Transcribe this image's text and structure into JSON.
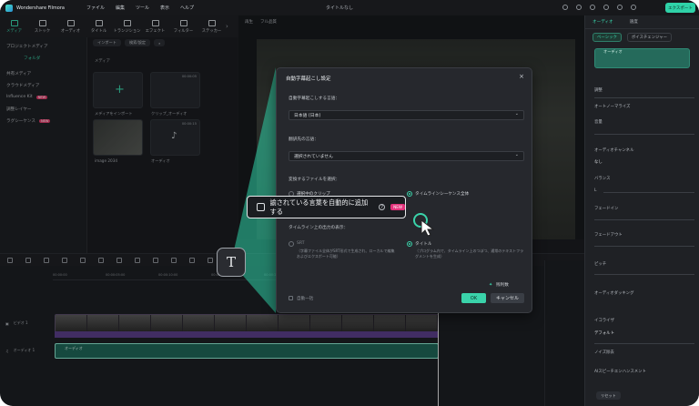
{
  "app": {
    "name": "Wondershare Filmora",
    "window_title": "タイトルなし",
    "export_label": "エクスポート"
  },
  "menu": [
    "ファイル",
    "編集",
    "ツール",
    "表示",
    "ヘルプ"
  ],
  "tools": [
    "メディア",
    "ストック",
    "オーディオ",
    "タイトル",
    "トランジション",
    "エフェクト",
    "フィルター",
    "ステッカー"
  ],
  "left_panel": {
    "items": [
      "プロジェクトメディア",
      "フォルダ",
      "共有メディア",
      "クラウドメディア",
      "Influence Kit",
      "調整レイヤー",
      "ラグシーケンス"
    ],
    "new_badge": "NEW"
  },
  "media": {
    "import_label": "インポート",
    "filter_label": "検索/設定",
    "folder_label": "メディア",
    "items": [
      {
        "caption": "メディアをインポート"
      },
      {
        "caption": "クリップ_オーディオ",
        "time": "00:00:05"
      },
      {
        "caption": "image 2034"
      },
      {
        "caption": "オーディオ",
        "time": "00:00:15"
      }
    ]
  },
  "preview": {
    "label": "再生",
    "quality": "フル品質"
  },
  "right_panel": {
    "tabs": [
      "オーディオ",
      "速度"
    ],
    "subtabs": [
      "ベーシック",
      "ボイスチェンジャー"
    ],
    "wave_label": "オーディオ",
    "sections": [
      "調整",
      "オートノーマライズ",
      "音量",
      "オーディオチャンネル",
      "なし",
      "バランス",
      "L",
      "フェードイン",
      "フェードアウト",
      "ピッチ",
      "オーディオダッキング",
      "イコライザ",
      "デフォルト",
      "ノイズ除去",
      "AIスピーチエンハンスメント"
    ],
    "reset_label": "リセット"
  },
  "timeline": {
    "ruler": [
      "00:00:00",
      "00:00:05:00",
      "00:00:10:00",
      "00:00:15:00",
      "00:00:20:00",
      "00:00:25:00"
    ],
    "video_track": "ビデオ 1",
    "audio_track": "オーディオ 1",
    "audio_clip_label": "オーディオ"
  },
  "dialog": {
    "title": "自動字幕起こし設定",
    "source_lang_label": "自動字幕起こしする言語：",
    "source_lang_value": "日本語 (日本)",
    "translate_label": "翻訳先の言語：",
    "translate_value": "選択されていません",
    "file_label": "変換するファイルを選択：",
    "option_selected_clip": "選択中のクリップ",
    "option_timeline": "タイムラインシーケンス全体",
    "output_label": "タイムライン上の出力の表示：",
    "srt_label": "SRT",
    "srt_note": "（字幕ファイル全体がSRT形式で生成され、ローカルで編集およびエクスポート可能）",
    "title_label": "タイトル",
    "title_note": "（プログラム内で、タイムライン上のつぼつ、通常のテキストフラグメントを生成）",
    "auto_label": "自動一括",
    "remaining_label": "残利数",
    "ok_label": "OK",
    "cancel_label": "キャンセル"
  },
  "callout": {
    "text": "諭されている言葉を自動的に追加する",
    "badge": "NEW"
  }
}
